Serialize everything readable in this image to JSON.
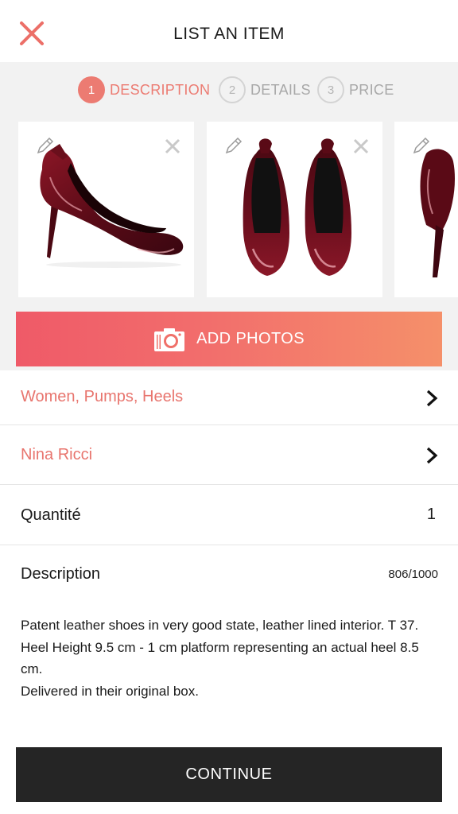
{
  "header": {
    "title": "LIST AN ITEM",
    "close_icon": "close-x-icon",
    "accent_color": "#ec7b72"
  },
  "steps": [
    {
      "number": "1",
      "label": "DESCRIPTION",
      "state": "active"
    },
    {
      "number": "2",
      "label": "DETAILS",
      "state": "inactive"
    },
    {
      "number": "3",
      "label": "PRICE",
      "state": "inactive"
    }
  ],
  "photos": [
    {
      "subject": "burgundy patent pump, side view",
      "edit_icon": "pencil-icon",
      "remove_icon": "close-icon"
    },
    {
      "subject": "burgundy patent pumps, pair rear view",
      "edit_icon": "pencil-icon",
      "remove_icon": "close-icon"
    },
    {
      "subject": "burgundy patent pump, back view (partially visible)",
      "edit_icon": "pencil-icon"
    }
  ],
  "add_photos": {
    "label": "ADD PHOTOS",
    "icon": "camera-icon"
  },
  "category": {
    "label": "Women, Pumps, Heels"
  },
  "brand": {
    "label": "Nina Ricci"
  },
  "quantity": {
    "label": "Quantité",
    "value": "1"
  },
  "description": {
    "label": "Description",
    "counter": "806/1000",
    "text": "Patent leather shoes in very good state, leather lined interior. T 37. Heel Height 9.5 cm - 1 cm platform representing an actual heel 8.5 cm.\nDelivered in their original box."
  },
  "continue": {
    "label": "CONTINUE"
  }
}
